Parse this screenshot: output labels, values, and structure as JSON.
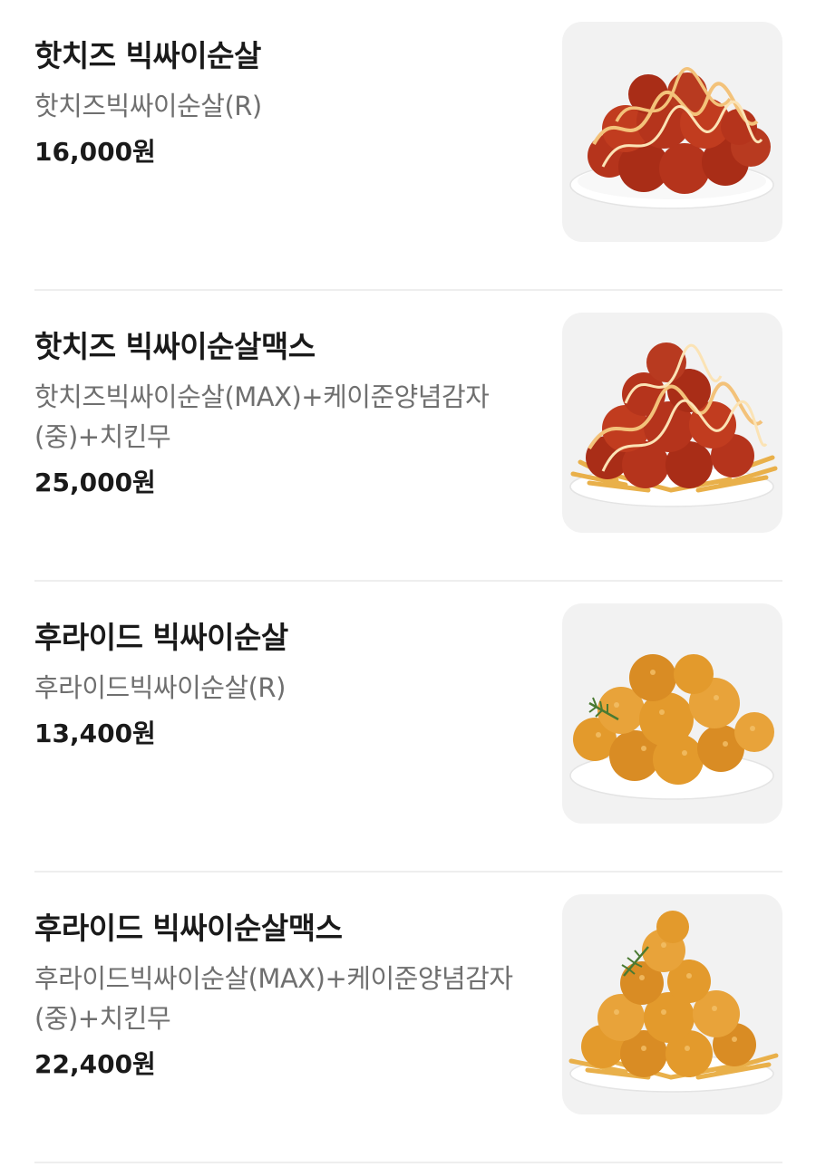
{
  "menu": {
    "items": [
      {
        "name": "핫치즈 빅싸이순살",
        "description": "핫치즈빅싸이순살(R)",
        "price": "16,000원",
        "image_icon": "hot-cheese-chicken-photo"
      },
      {
        "name": "핫치즈 빅싸이순살맥스",
        "description": "핫치즈빅싸이순살(MAX)+케이준양념감자(중)+치킨무",
        "price": "25,000원",
        "image_icon": "hot-cheese-chicken-max-photo"
      },
      {
        "name": "후라이드 빅싸이순살",
        "description": "후라이드빅싸이순살(R)",
        "price": "13,400원",
        "image_icon": "fried-chicken-photo"
      },
      {
        "name": "후라이드 빅싸이순살맥스",
        "description": "후라이드빅싸이순살(MAX)+케이준양념감자(중)+치킨무",
        "price": "22,400원",
        "image_icon": "fried-chicken-max-photo"
      }
    ]
  },
  "colors": {
    "sauced_chicken": "#b5341c",
    "fried_chicken": "#e39a2c",
    "plate": "#ffffff",
    "image_bg": "#f2f2f2"
  }
}
